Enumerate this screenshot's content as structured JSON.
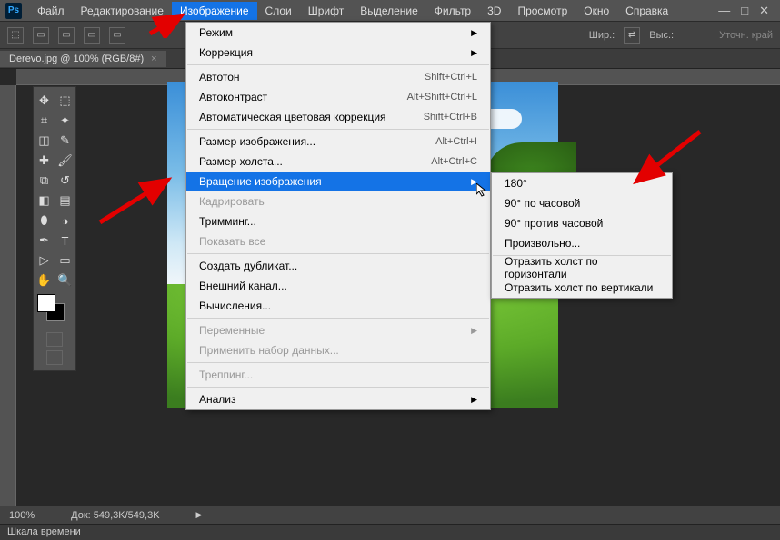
{
  "app": {
    "logo": "Ps"
  },
  "menubar": {
    "items": [
      "Файл",
      "Редактирование",
      "Изображение",
      "Слои",
      "Шрифт",
      "Выделение",
      "Фильтр",
      "3D",
      "Просмотр",
      "Окно",
      "Справка"
    ],
    "activeIndex": 2
  },
  "optbar": {
    "width_label": "Шир.:",
    "height_label": "Выс.:",
    "refine_label": "Уточн. край"
  },
  "doctab": {
    "title": "Derevo.jpg @ 100% (RGB/8#)",
    "close": "×"
  },
  "status": {
    "zoom": "100%",
    "docsize": "Док: 549,3K/549,3K"
  },
  "timeline": {
    "label": "Шкала времени"
  },
  "dropdown1": {
    "groups": [
      [
        {
          "label": "Режим",
          "submenu": true
        },
        {
          "label": "Коррекция",
          "submenu": true
        }
      ],
      [
        {
          "label": "Автотон",
          "shortcut": "Shift+Ctrl+L"
        },
        {
          "label": "Автоконтраст",
          "shortcut": "Alt+Shift+Ctrl+L"
        },
        {
          "label": "Автоматическая цветовая коррекция",
          "shortcut": "Shift+Ctrl+B"
        }
      ],
      [
        {
          "label": "Размер изображения...",
          "shortcut": "Alt+Ctrl+I"
        },
        {
          "label": "Размер холста...",
          "shortcut": "Alt+Ctrl+C"
        },
        {
          "label": "Вращение изображения",
          "submenu": true,
          "highlight": true
        },
        {
          "label": "Кадрировать",
          "disabled": true
        },
        {
          "label": "Тримминг..."
        },
        {
          "label": "Показать все",
          "disabled": true
        }
      ],
      [
        {
          "label": "Создать дубликат..."
        },
        {
          "label": "Внешний канал..."
        },
        {
          "label": "Вычисления..."
        }
      ],
      [
        {
          "label": "Переменные",
          "submenu": true,
          "disabled": true
        },
        {
          "label": "Применить набор данных...",
          "disabled": true
        }
      ],
      [
        {
          "label": "Треппинг...",
          "disabled": true
        }
      ],
      [
        {
          "label": "Анализ",
          "submenu": true
        }
      ]
    ]
  },
  "dropdown2": {
    "groups": [
      [
        {
          "label": "180°"
        },
        {
          "label": "90° по часовой"
        },
        {
          "label": "90° против часовой"
        },
        {
          "label": "Произвольно..."
        }
      ],
      [
        {
          "label": "Отразить холст по горизонтали"
        },
        {
          "label": "Отразить холст по вертикали"
        }
      ]
    ]
  },
  "tools": {
    "rows": [
      [
        "move",
        "marquee"
      ],
      [
        "lasso",
        "magic-wand"
      ],
      [
        "crop",
        "eyedropper"
      ],
      [
        "spot-heal",
        "brush"
      ],
      [
        "stamp",
        "history-brush"
      ],
      [
        "eraser",
        "gradient"
      ],
      [
        "blur",
        "dodge"
      ],
      [
        "pen",
        "type"
      ],
      [
        "path-select",
        "rectangle"
      ],
      [
        "hand",
        "zoom"
      ]
    ],
    "glyphs": [
      [
        "✥",
        "⬚"
      ],
      [
        "⌗",
        "✦"
      ],
      [
        "◫",
        "✎"
      ],
      [
        "✚",
        "🖌"
      ],
      [
        "⧉",
        "↺"
      ],
      [
        "◧",
        "▤"
      ],
      [
        "⬮",
        "◑"
      ],
      [
        "✒",
        "T"
      ],
      [
        "▷",
        "▭"
      ],
      [
        "✋",
        "🔍"
      ]
    ]
  }
}
